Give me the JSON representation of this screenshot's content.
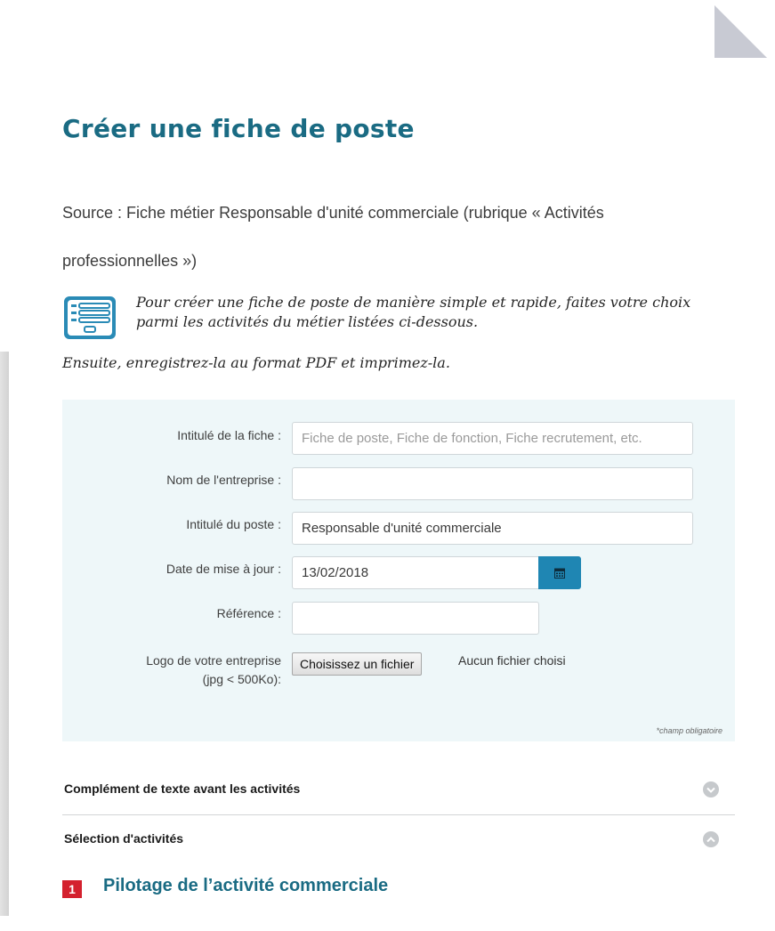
{
  "page": {
    "title": "Créer une fiche de poste",
    "source": "Source : Fiche métier Responsable d'unité commerciale (rubrique « Activités professionnelles »)"
  },
  "intro": {
    "icon": "document-list-icon",
    "text_1": "Pour créer une fiche de poste de manière simple et rapide, faites votre choix parmi les activités du métier listées ci-dessous.",
    "text_2": "Ensuite, enregistrez-la au format PDF et imprimez-la."
  },
  "form": {
    "fiche_title": {
      "label": "Intitulé de la fiche :",
      "value": "",
      "placeholder": "Fiche de poste, Fiche de fonction, Fiche recrutement, etc."
    },
    "company_name": {
      "label": "Nom de l'entreprise :",
      "value": ""
    },
    "job_title": {
      "label": "Intitulé du poste :",
      "value": "Responsable d'unité commerciale"
    },
    "update_date": {
      "label": "Date de mise à jour :",
      "value": "13/02/2018",
      "button_icon": "calendar-icon"
    },
    "reference": {
      "label": "Référence :",
      "value": ""
    },
    "logo": {
      "label_line1": "Logo de votre entreprise",
      "label_line2": "(jpg < 500Ko):",
      "button": "Choisissez un fichier",
      "status": "Aucun fichier choisi"
    },
    "required_note": "*champ obligatoire"
  },
  "accordion": [
    {
      "title": "Complément de texte avant les activités",
      "state": "collapsed",
      "icon": "chevron-down-icon"
    },
    {
      "title": "Sélection d'activités",
      "state": "expanded",
      "icon": "chevron-up-icon"
    }
  ],
  "activities": [
    {
      "number": "1",
      "title": "Pilotage de l’activité commerciale"
    }
  ],
  "colors": {
    "title": "#1a6b83",
    "panel_background": "#eef7f9",
    "calendar_button": "#1f86b3",
    "activity_badge": "#d4212e",
    "accordion_icon": "#c6c9cc"
  }
}
